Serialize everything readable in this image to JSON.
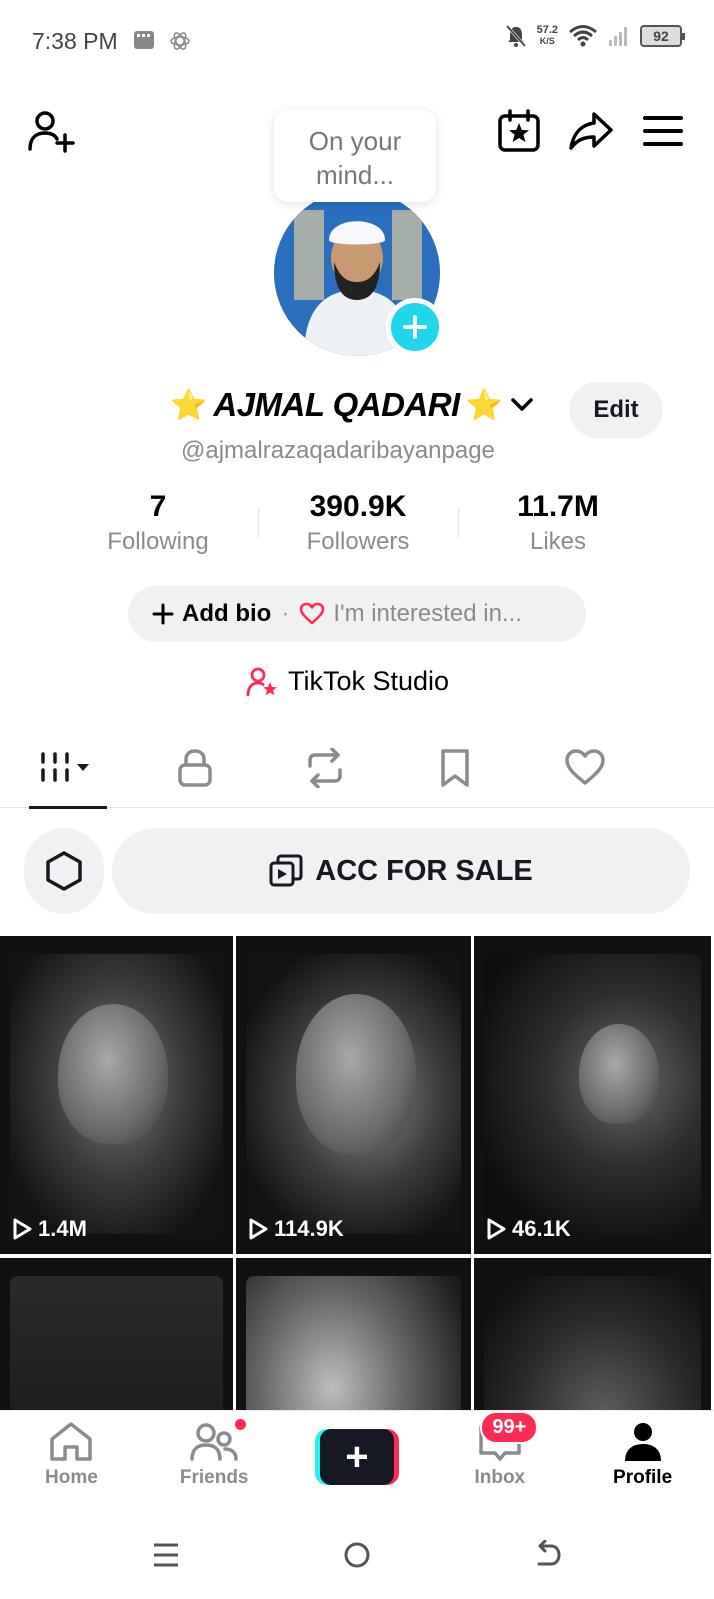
{
  "status_bar": {
    "time": "7:38 PM",
    "net_speed_value": "57.2",
    "net_speed_unit": "K/S",
    "battery": "92"
  },
  "header": {
    "bubble_text_line1": "On your",
    "bubble_text_line2": "mind..."
  },
  "profile": {
    "display_name": "AJMAL QADARI",
    "name_emoji_left": "⭐",
    "name_emoji_right": "⭐",
    "handle": "@ajmalrazaqadaribayanpage",
    "edit_label": "Edit"
  },
  "stats": [
    {
      "value": "7",
      "label": "Following"
    },
    {
      "value": "390.9K",
      "label": "Followers"
    },
    {
      "value": "11.7M",
      "label": "Likes"
    }
  ],
  "bio": {
    "add_label": "Add bio",
    "separator": "·",
    "interest_label": "I'm interested in..."
  },
  "studio": {
    "label": "TikTok Studio"
  },
  "action": {
    "sale_label": "ACC FOR SALE"
  },
  "videos": [
    {
      "views": "1.4M"
    },
    {
      "views": "114.9K"
    },
    {
      "views": "46.1K"
    },
    {
      "views": ""
    },
    {
      "views": ""
    },
    {
      "views": ""
    }
  ],
  "bottom_nav": {
    "home": "Home",
    "friends": "Friends",
    "inbox": "Inbox",
    "inbox_badge": "99+",
    "profile": "Profile",
    "create_symbol": "+"
  },
  "colors": {
    "accent_red": "#fe2c55",
    "accent_cyan": "#20d5ec",
    "text_primary": "#161823",
    "text_secondary": "#8a8b91"
  }
}
